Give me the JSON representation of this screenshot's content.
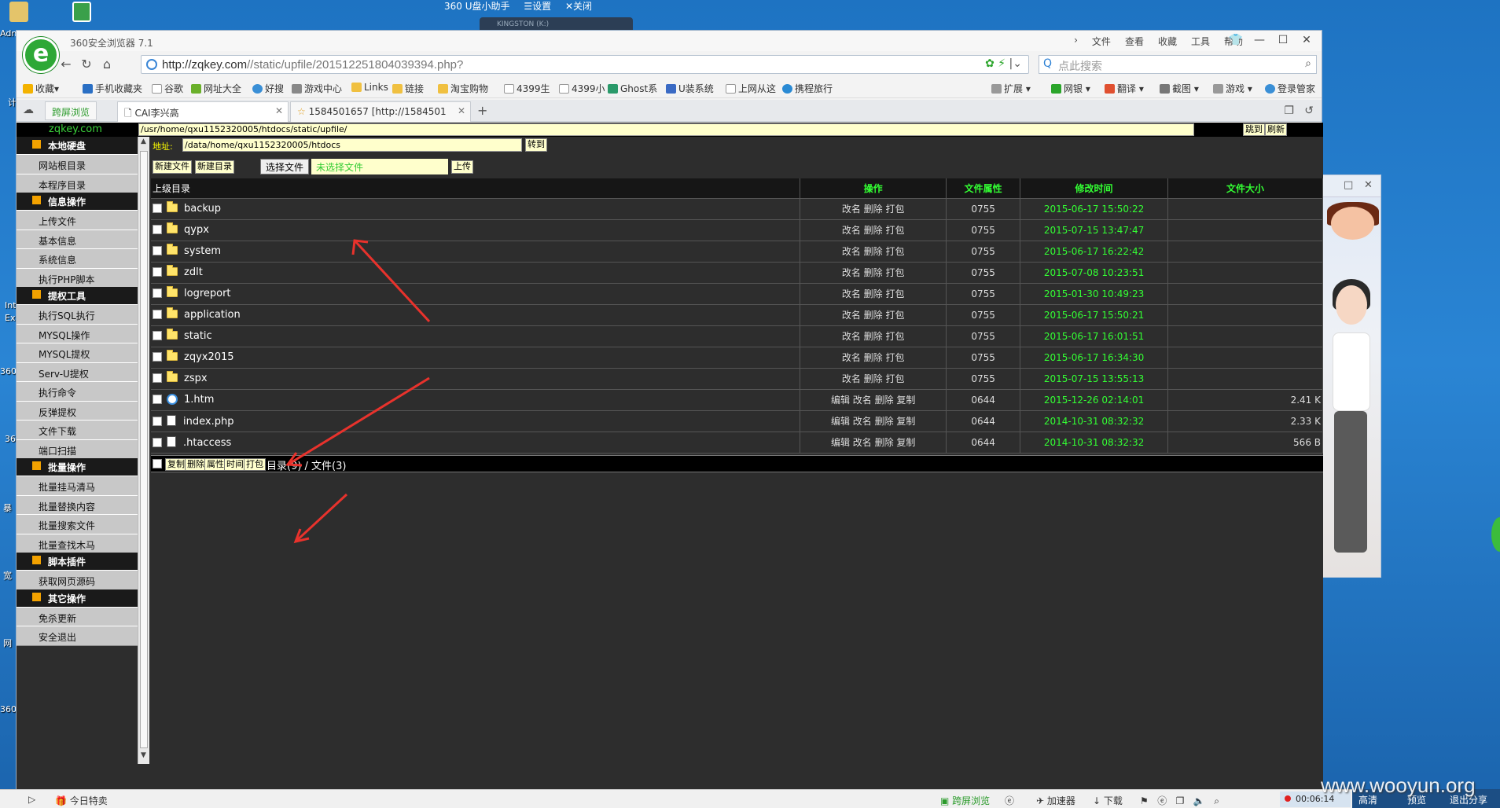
{
  "desktop": {
    "labels": [
      "Adn",
      "计",
      "Int",
      "Ex",
      "360",
      "36",
      "暴",
      "宽",
      "网",
      "360"
    ],
    "u_helper": {
      "title": "360 U盘小助手",
      "settings": "☰设置",
      "close": "✕关闭"
    },
    "kingston": "KINGSTON (K:)"
  },
  "browser": {
    "title": "360安全浏览器 7.1",
    "menu": [
      "文件",
      "查看",
      "收藏",
      "工具",
      "帮助"
    ],
    "url_host": "http://zqkey.com",
    "url_path": "//static/upfile/201512251804039394.php?",
    "search_placeholder": "点此搜索",
    "favorites": [
      "收藏",
      "手机收藏夹",
      "谷歌",
      "网址大全",
      "好搜",
      "游戏中心",
      "Links",
      "链接",
      "淘宝购物",
      "4399生",
      "4399小",
      "Ghost系",
      "U装系统",
      "上网从这",
      "携程旅行"
    ],
    "fav_right": [
      "扩展",
      "网银",
      "翻译",
      "截图",
      "游戏",
      "登录管家"
    ],
    "split_label": "跨屏浏览",
    "tabs": [
      {
        "label": "CAI李兴高"
      },
      {
        "label": "1584501657 [http://1584501"
      }
    ]
  },
  "shell": {
    "site": "zqkey.com",
    "path_value": "/usr/home/qxu1152320005/htdocs/static/upfile/",
    "jump_label": "跳到",
    "refresh_label": "刷新",
    "loc_label": "地址:",
    "loc_value": "/data/home/qxu1152320005/htdocs",
    "goto_label": "转到",
    "new_file_label": "新建文件",
    "new_dir_label": "新建目录",
    "choose_file_label": "选择文件",
    "no_file_label": "未选择文件",
    "upload_label": "上传",
    "sidebar": [
      {
        "type": "head",
        "label": "本地硬盘"
      },
      {
        "type": "item",
        "label": "网站根目录"
      },
      {
        "type": "item",
        "label": "本程序目录"
      },
      {
        "type": "head",
        "label": "信息操作"
      },
      {
        "type": "item",
        "label": "上传文件"
      },
      {
        "type": "item",
        "label": "基本信息"
      },
      {
        "type": "item",
        "label": "系统信息"
      },
      {
        "type": "item",
        "label": "执行PHP脚本"
      },
      {
        "type": "head",
        "label": "提权工具"
      },
      {
        "type": "item",
        "label": "执行SQL执行"
      },
      {
        "type": "item",
        "label": "MYSQL操作"
      },
      {
        "type": "item",
        "label": "MYSQL提权"
      },
      {
        "type": "item",
        "label": "Serv-U提权"
      },
      {
        "type": "item",
        "label": "执行命令"
      },
      {
        "type": "item",
        "label": "反弹提权"
      },
      {
        "type": "item",
        "label": "文件下载"
      },
      {
        "type": "item",
        "label": "端口扫描"
      },
      {
        "type": "head",
        "label": "批量操作"
      },
      {
        "type": "item",
        "label": "批量挂马清马"
      },
      {
        "type": "item",
        "label": "批量替换内容"
      },
      {
        "type": "item",
        "label": "批量搜索文件"
      },
      {
        "type": "item",
        "label": "批量查找木马"
      },
      {
        "type": "head",
        "label": "脚本插件"
      },
      {
        "type": "item",
        "label": "获取网页源码"
      },
      {
        "type": "head",
        "label": "其它操作"
      },
      {
        "type": "item",
        "label": "免杀更新"
      },
      {
        "type": "item",
        "label": "安全退出"
      }
    ],
    "table": {
      "headers": [
        "上级目录",
        "操作",
        "文件属性",
        "修改时间",
        "文件大小"
      ],
      "rows": [
        {
          "name": "backup",
          "kind": "folder",
          "ops": "改名 删除 打包",
          "perm": "0755",
          "time": "2015-06-17 15:50:22",
          "size": ""
        },
        {
          "name": "qypx",
          "kind": "folder",
          "ops": "改名 删除 打包",
          "perm": "0755",
          "time": "2015-07-15 13:47:47",
          "size": ""
        },
        {
          "name": "system",
          "kind": "folder",
          "ops": "改名 删除 打包",
          "perm": "0755",
          "time": "2015-06-17 16:22:42",
          "size": ""
        },
        {
          "name": "zdlt",
          "kind": "folder",
          "ops": "改名 删除 打包",
          "perm": "0755",
          "time": "2015-07-08 10:23:51",
          "size": ""
        },
        {
          "name": "logreport",
          "kind": "folder",
          "ops": "改名 删除 打包",
          "perm": "0755",
          "time": "2015-01-30 10:49:23",
          "size": ""
        },
        {
          "name": "application",
          "kind": "folder",
          "ops": "改名 删除 打包",
          "perm": "0755",
          "time": "2015-06-17 15:50:21",
          "size": ""
        },
        {
          "name": "static",
          "kind": "folder",
          "ops": "改名 删除 打包",
          "perm": "0755",
          "time": "2015-06-17 16:01:51",
          "size": ""
        },
        {
          "name": "zqyx2015",
          "kind": "folder",
          "ops": "改名 删除 打包",
          "perm": "0755",
          "time": "2015-06-17 16:34:30",
          "size": ""
        },
        {
          "name": "zspx",
          "kind": "folder",
          "ops": "改名 删除 打包",
          "perm": "0755",
          "time": "2015-07-15 13:55:13",
          "size": ""
        },
        {
          "name": "1.htm",
          "kind": "htm",
          "ops": "编辑 改名 删除 复制",
          "perm": "0644",
          "time": "2015-12-26 02:14:01",
          "size": "2.41 K"
        },
        {
          "name": "index.php",
          "kind": "file",
          "ops": "编辑 改名 删除 复制",
          "perm": "0644",
          "time": "2014-10-31 08:32:32",
          "size": "2.33 K"
        },
        {
          "name": ".htaccess",
          "kind": "file",
          "ops": "编辑 改名 删除 复制",
          "perm": "0644",
          "time": "2014-10-31 08:32:32",
          "size": "566 B"
        }
      ]
    },
    "footer_buttons": [
      "复制",
      "删除",
      "属性",
      "时间",
      "打包"
    ],
    "footer_count": "目录(9) / 文件(3)"
  },
  "statusbar": {
    "today": "今日特卖",
    "split": "跨屏浏览",
    "accel": "加速器",
    "download": "下载",
    "timer": "00:06:14",
    "right": [
      "高清",
      "预览",
      "退出分享"
    ]
  },
  "watermark": "www.wooyun.org",
  "colors": {
    "accent_green": "#33ff33",
    "shell_bg": "#2d2d2d",
    "input_bg": "#ffffcc",
    "arrow_red": "#e8322c"
  }
}
